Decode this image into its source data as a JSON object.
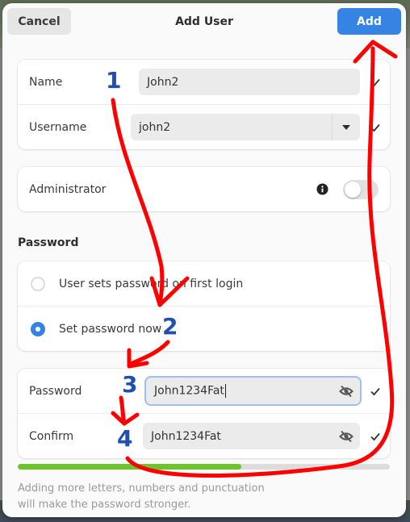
{
  "dialog": {
    "title": "Add User",
    "cancel_label": "Cancel",
    "add_label": "Add",
    "accent_color": "#3584e4"
  },
  "identity": {
    "name_label": "Name",
    "name_value": "John2",
    "username_label": "Username",
    "username_value": "john2"
  },
  "admin": {
    "label": "Administrator",
    "enabled": false
  },
  "password_section": {
    "title": "Password",
    "options": [
      {
        "label": "User sets password on first login",
        "selected": false
      },
      {
        "label": "Set password now",
        "selected": true
      }
    ],
    "password_label": "Password",
    "password_value": "John1234Fat",
    "confirm_label": "Confirm",
    "confirm_value": "John1234Fat",
    "strength_fraction": 0.6,
    "strength_color": "#6ac52a",
    "hint": "Adding more letters, numbers and punctuation will make the password stronger."
  },
  "annotations": {
    "step_numbers": [
      "1",
      "2",
      "3",
      "4"
    ],
    "arrow_color": "#ff0000",
    "number_color": "#1f4fb0"
  }
}
